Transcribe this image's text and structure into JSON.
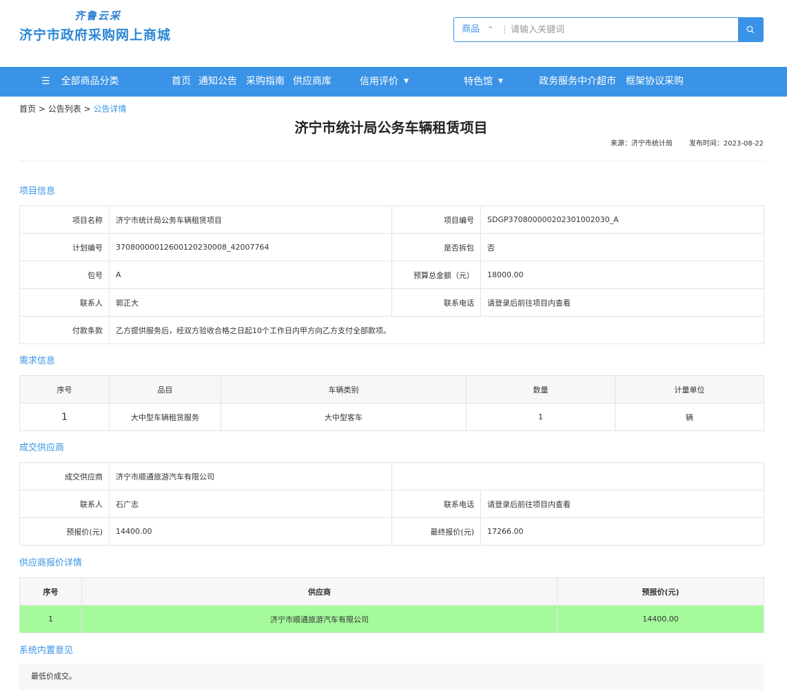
{
  "header": {
    "logo_small": "齐鲁云采",
    "logo_title": "济宁市政府采购网上商城",
    "search": {
      "category": "商品",
      "placeholder": "请输入关键词"
    }
  },
  "nav": {
    "all_categories": "全部商品分类",
    "items": [
      "首页",
      "通知公告",
      "采购指南",
      "供应商库"
    ],
    "credit": "信用评价",
    "special": "特色馆",
    "items2": [
      "政务服务中介超市",
      "框架协议采购"
    ]
  },
  "breadcrumb": {
    "home": "首页",
    "list": "公告列表",
    "current": "公告详情",
    "sep": ">"
  },
  "notice": {
    "title": "济宁市统计局公务车辆租赁项目",
    "source": "来源：济宁市统计局",
    "publish_time": "发布时间：2023-08-22"
  },
  "sections": {
    "project": "项目信息",
    "demand": "需求信息",
    "supplier": "成交供应商",
    "quote_detail": "供应商报价详情",
    "opinion": "系统内置意见"
  },
  "project": {
    "name_label": "项目名称",
    "name": "济宁市统计局公务车辆租赁项目",
    "code_label": "项目编号",
    "code": "SDGP370800000202301002030_A",
    "plan_label": "计划编号",
    "plan": "37080000012600120230008_42007764",
    "split_label": "是否拆包",
    "split": "否",
    "package_label": "包号",
    "package": "A",
    "budget_label": "预算总金额（元）",
    "budget": "18000.00",
    "contact_label": "联系人",
    "contact": "郭正大",
    "phone_label": "联系电话",
    "phone": "请登录后前往项目内查看",
    "payment_label": "付款条款",
    "payment": "乙方提供服务后，经双方验收合格之日起10个工作日内甲方向乙方支付全部款项。"
  },
  "demand": {
    "headers": [
      "序号",
      "品目",
      "车辆类别",
      "数量",
      "计量单位"
    ],
    "rows": [
      [
        "1",
        "大中型车辆租赁服务",
        "大中型客车",
        "1",
        "辆"
      ]
    ]
  },
  "winner": {
    "supplier_label": "成交供应商",
    "supplier": "济宁市顺通旅游汽车有限公司",
    "contact_label": "联系人",
    "contact": "石广志",
    "phone_label": "联系电话",
    "phone": "请登录后前往项目内查看",
    "pre_price_label": "预报价(元)",
    "pre_price": "14400.00",
    "final_price_label": "最终报价(元)",
    "final_price": "17266.00"
  },
  "quotes": {
    "headers": [
      "序号",
      "供应商",
      "预报价(元)"
    ],
    "rows": [
      [
        "1",
        "济宁市顺通旅游汽车有限公司",
        "14400.00"
      ]
    ],
    "highlight_color": "#a5fb9c"
  },
  "opinion": {
    "text": "最低价成交。"
  },
  "colors": {
    "accent": "#3a93e6"
  }
}
